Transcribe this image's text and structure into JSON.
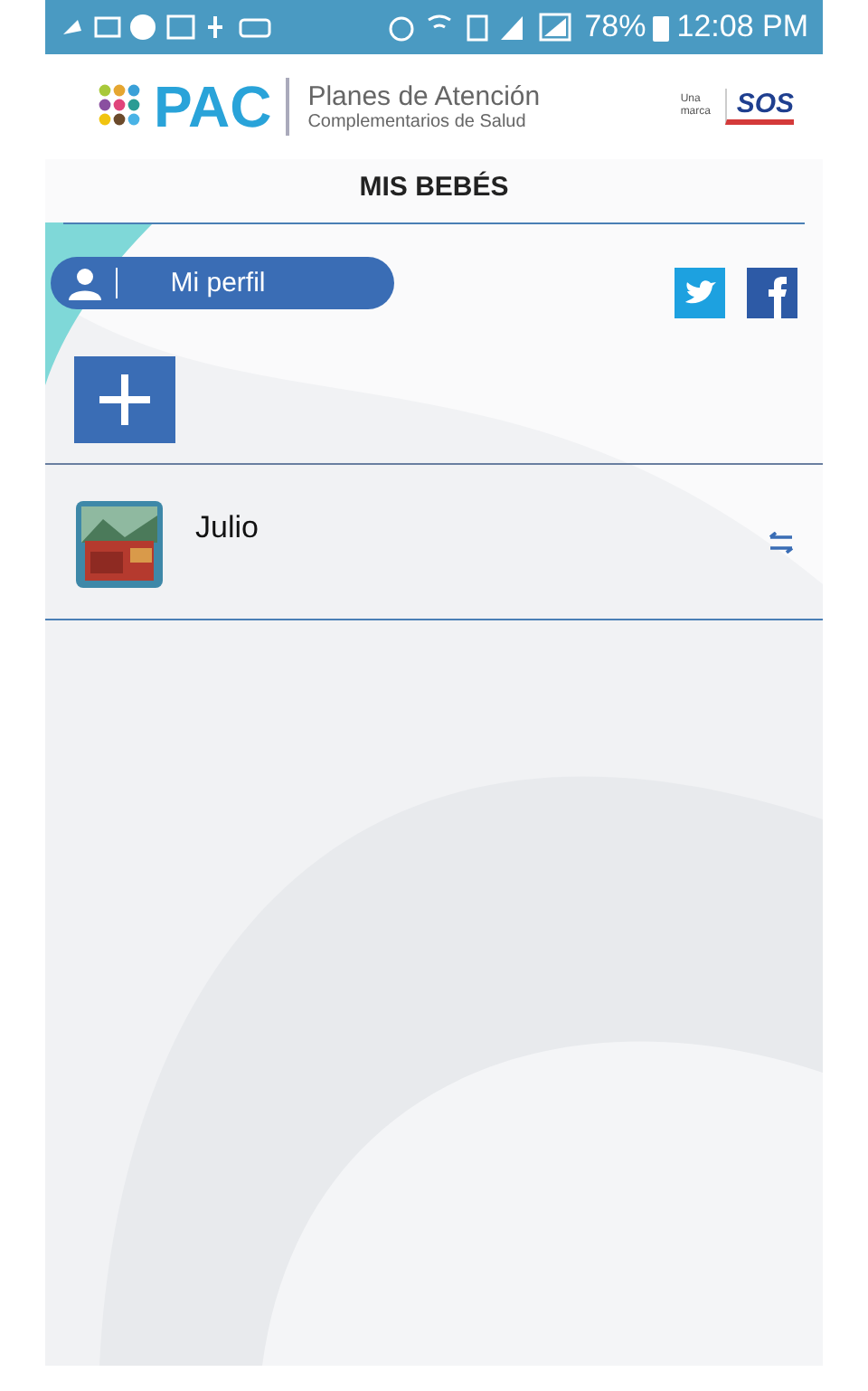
{
  "status_bar": {
    "battery": "78%",
    "time": "12:08 PM"
  },
  "header": {
    "brand": "PAC",
    "tagline": [
      "Planes de Atención",
      "Complementarios de Salud"
    ],
    "partner_prefix": "Una marca",
    "partner": "SOS"
  },
  "title": "MIS BEBÉS",
  "profile_button": {
    "label": "Mi perfil"
  },
  "babies": [
    {
      "name": "Julio",
      "kind": "picture"
    }
  ]
}
